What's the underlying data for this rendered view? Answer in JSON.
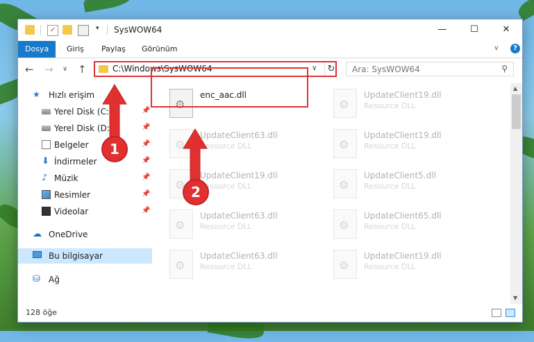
{
  "window": {
    "title": "SysWOW64",
    "min_glyph": "—",
    "max_glyph": "☐",
    "close_glyph": "✕"
  },
  "ribbon": {
    "tabs": [
      {
        "label": "Dosya",
        "active": true
      },
      {
        "label": "Giriş"
      },
      {
        "label": "Paylaş"
      },
      {
        "label": "Görünüm"
      }
    ],
    "help_glyph": "?",
    "collapse_glyph": "∨"
  },
  "nav": {
    "back_glyph": "←",
    "forward_glyph": "→",
    "recent_glyph": "∨",
    "up_glyph": "↑",
    "address": "C:\\Windows\\SysWOW64",
    "address_dropdown_glyph": "∨",
    "refresh_glyph": "↻",
    "search_placeholder": "Ara: SysWOW64",
    "search_icon_glyph": "⚲"
  },
  "sidebar": {
    "items": [
      {
        "label": "Hızlı erişim",
        "icon": "star-icon",
        "glyph": "★"
      },
      {
        "label": "Yerel Disk (C:)",
        "icon": "disk-icon",
        "pinned": true
      },
      {
        "label": "Yerel Disk (D:)",
        "icon": "disk-icon",
        "pinned": true
      },
      {
        "label": "Belgeler",
        "icon": "documents-icon",
        "pinned": true
      },
      {
        "label": "İndirmeler",
        "icon": "download-icon",
        "glyph": "⬇",
        "pinned": true
      },
      {
        "label": "Müzik",
        "icon": "music-icon",
        "glyph": "♪",
        "pinned": true
      },
      {
        "label": "Resimler",
        "icon": "pictures-icon",
        "pinned": true
      },
      {
        "label": "Videolar",
        "icon": "videos-icon",
        "pinned": true
      },
      {
        "label": "OneDrive",
        "icon": "cloud-icon",
        "glyph": "☁"
      },
      {
        "label": "Bu bilgisayar",
        "icon": "computer-icon",
        "selected": true
      },
      {
        "label": "Ağ",
        "icon": "network-icon",
        "glyph": "⛁"
      }
    ],
    "pin_glyph": "📌"
  },
  "files": [
    {
      "name": "enc_aac.dll",
      "desc": "",
      "highlighted": true
    },
    {
      "name": "UpdateClient19.dll",
      "desc": "Resource DLL"
    },
    {
      "name": "UpdateClient63.dll",
      "desc": "Resource DLL"
    },
    {
      "name": "UpdateClient19.dll",
      "desc": "Resource DLL"
    },
    {
      "name": "UpdateClient19.dll",
      "desc": "Resource DLL"
    },
    {
      "name": "UpdateClient5.dll",
      "desc": "Resource DLL"
    },
    {
      "name": "UpdateClient63.dll",
      "desc": "Resource DLL"
    },
    {
      "name": "UpdateClient65.dll",
      "desc": "Resource DLL"
    },
    {
      "name": "UpdateClient63.dll",
      "desc": "Resource DLL"
    },
    {
      "name": "UpdateClient19.dll",
      "desc": "Resource DLL"
    }
  ],
  "scrollbar": {
    "up_glyph": "▲",
    "down_glyph": "▼"
  },
  "status": {
    "item_count": "128 öğe"
  },
  "annotations": {
    "marker1": "1",
    "marker2": "2"
  },
  "colors": {
    "accent": "#1979ca",
    "highlight": "#e03030",
    "selection": "#cce8ff"
  }
}
